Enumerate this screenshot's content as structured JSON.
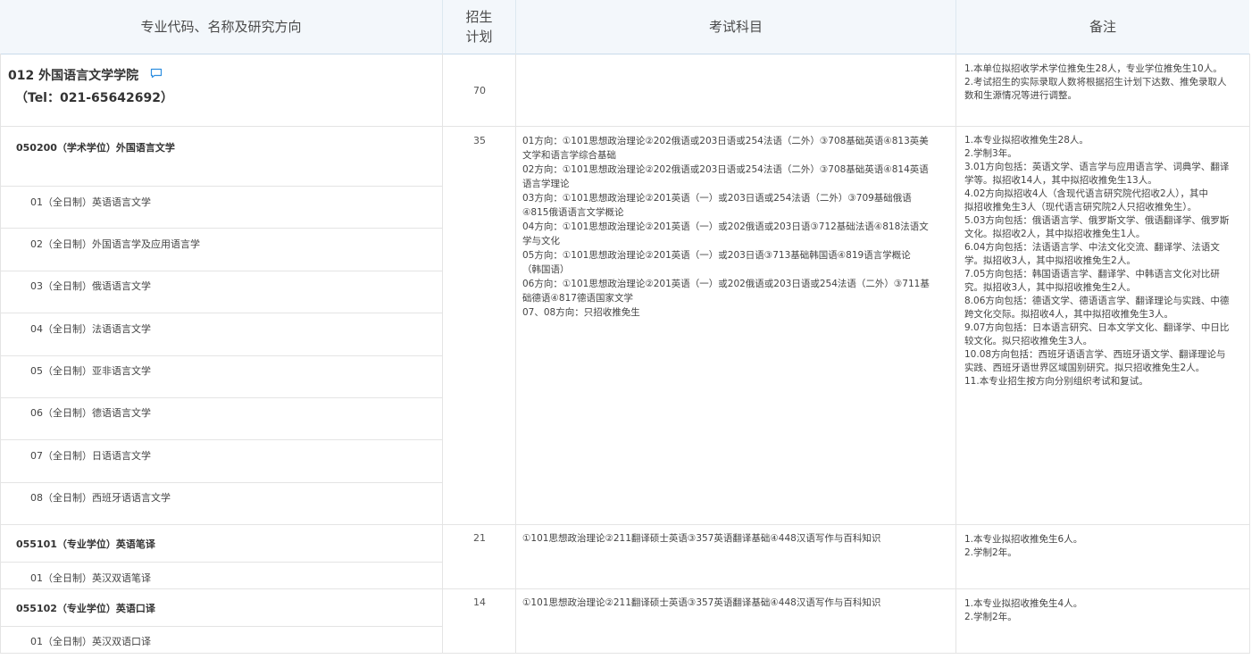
{
  "header": {
    "col1": "专业代码、名称及研究方向",
    "col2_line1": "招生",
    "col2_line2": "计划",
    "col3": "考试科目",
    "col4": "备注"
  },
  "department": {
    "name": "012 外国语言文学学院",
    "tel": "（Tel：021-65642692）",
    "plan": "70",
    "notes": [
      "1.本单位拟招收学术学位推免生28人，专业学位推免生10人。",
      "2.考试招生的实际录取人数将根据招生计划下达数、推免录取人",
      "数和生源情况等进行调整。"
    ]
  },
  "majors": [
    {
      "title": "050200（学术学位）外国语言文学",
      "plan": "35",
      "directions": [
        "01（全日制）英语语言文学",
        "02（全日制）外国语言学及应用语言学",
        "03（全日制）俄语语言文学",
        "04（全日制）法语语言文学",
        "05（全日制）亚非语言文学",
        "06（全日制）德语语言文学",
        "07（全日制）日语语言文学",
        "08（全日制）西班牙语语言文学"
      ],
      "subjects": [
        "01方向：①101思想政治理论②202俄语或203日语或254法语（二外）③708基础英语④813英美",
        "文学和语言学综合基础",
        "02方向：①101思想政治理论②202俄语或203日语或254法语（二外）③708基础英语④814英语",
        "语言学理论",
        "03方向：①101思想政治理论②201英语（一）或203日语或254法语（二外）③709基础俄语",
        "④815俄语语言文学概论",
        "04方向：①101思想政治理论②201英语（一）或202俄语或203日语③712基础法语④818法语文",
        "学与文化",
        "05方向：①101思想政治理论②201英语（一）或203日语③713基础韩国语④819语言学概论",
        "（韩国语）",
        "06方向：①101思想政治理论②201英语（一）或202俄语或203日语或254法语（二外）③711基",
        "础德语④817德语国家文学",
        "07、08方向：只招收推免生"
      ],
      "notes": [
        "1.本专业拟招收推免生28人。",
        "2.学制3年。",
        "3.01方向包括：英语文学、语言学与应用语言学、词典学、翻译",
        "学等。拟招收14人，其中拟招收推免生13人。",
        "4.02方向拟招收4人（含现代语言研究院代招收2人），其中",
        "拟招收推免生3人（现代语言研究院2人只招收推免生）。",
        "5.03方向包括：俄语语言学、俄罗斯文学、俄语翻译学、俄罗斯",
        "文化。拟招收2人，其中拟招收推免生1人。",
        "6.04方向包括：法语语言学、中法文化交流、翻译学、法语文",
        "学。拟招收3人，其中拟招收推免生2人。",
        "7.05方向包括：韩国语语言学、翻译学、中韩语言文化对比研",
        "究。拟招收3人，其中拟招收推免生2人。",
        "8.06方向包括：德语文学、德语语言学、翻译理论与实践、中德",
        "跨文化交际。拟招收4人，其中拟招收推免生3人。",
        "9.07方向包括：日本语言研究、日本文学文化、翻译学、中日比",
        "较文化。拟只招收推免生3人。",
        "10.08方向包括：西班牙语语言学、西班牙语文学、翻译理论与",
        "实践、西班牙语世界区域国别研究。拟只招收推免生2人。",
        "11.本专业招生按方向分别组织考试和复试。"
      ]
    },
    {
      "title": "055101（专业学位）英语笔译",
      "plan": "21",
      "directions": [
        "01（全日制）英汉双语笔译"
      ],
      "subjects": [
        "①101思想政治理论②211翻译硕士英语③357英语翻译基础④448汉语写作与百科知识"
      ],
      "notes": [
        "1.本专业拟招收推免生6人。",
        "2.学制2年。"
      ]
    },
    {
      "title": "055102（专业学位）英语口译",
      "plan": "14",
      "directions": [
        "01（全日制）英汉双语口译"
      ],
      "subjects": [
        "①101思想政治理论②211翻译硕士英语③357英语翻译基础④448汉语写作与百科知识"
      ],
      "notes": [
        "1.本专业拟招收推免生4人。",
        "2.学制2年。"
      ]
    }
  ],
  "icons": {
    "chat": "chat-bubble-icon"
  },
  "colors": {
    "header_bg": "#f3f7fb",
    "icon_blue": "#2f8fe0"
  }
}
